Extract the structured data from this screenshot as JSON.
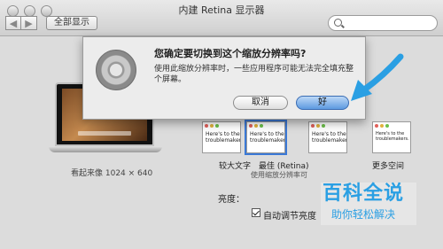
{
  "window": {
    "title": "内建 Retina 显示器",
    "show_all": "全部显示",
    "nav_back": "◀",
    "nav_forward": "▶",
    "search_placeholder": ""
  },
  "dialog": {
    "title": "您确定要切换到这个缩放分辨率吗?",
    "message": "使用此缩放分辨率时，一些应用程序可能无法完全填充整个屏幕。",
    "cancel_label": "取消",
    "ok_label": "好"
  },
  "display": {
    "looks_like": "看起来像 1024 × 640",
    "thumbnail_text": "Here's to the troublemakers.",
    "options": [
      {
        "label": "较大文字"
      },
      {
        "label": "最佳 (Retina)"
      },
      {
        "label": ""
      },
      {
        "label": "更多空间"
      }
    ],
    "scaled_note": "使用缩放分辨率可",
    "brightness_label": "亮度：",
    "auto_brightness_label": "自动调节亮度",
    "auto_brightness_checked": true
  },
  "watermark": {
    "title": "百科全说",
    "subtitle": "助你轻松解决"
  },
  "colors": {
    "accent": "#3b79d6",
    "arrow": "#2a9fe3"
  }
}
